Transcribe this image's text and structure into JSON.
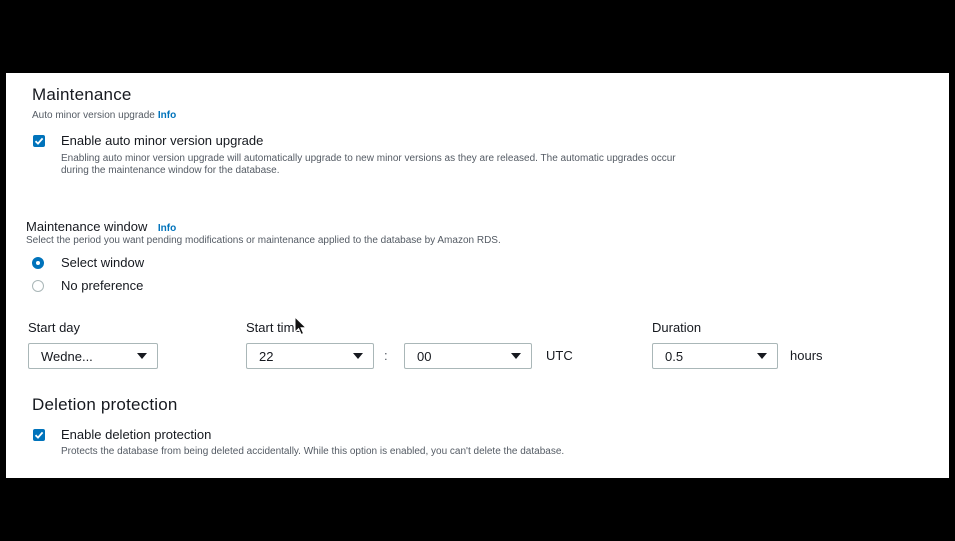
{
  "maintenance": {
    "title": "Maintenance",
    "subtitle": "Auto minor version upgrade",
    "subtitle_info": "Info",
    "auto_upgrade": {
      "checked": true,
      "label": "Enable auto minor version upgrade",
      "description": "Enabling auto minor version upgrade will automatically upgrade to new minor versions as they are released. The automatic upgrades occur during the maintenance window for the database."
    }
  },
  "window": {
    "title": "Maintenance window",
    "info": "Info",
    "description": "Select the period you want pending modifications or maintenance applied to the database by Amazon RDS.",
    "options": [
      {
        "label": "Select window",
        "selected": true
      },
      {
        "label": "No preference",
        "selected": false
      }
    ],
    "start_day": {
      "label": "Start day",
      "value": "Wedne..."
    },
    "start_time": {
      "label": "Start time",
      "hour": "22",
      "separator": ":",
      "minute": "00",
      "timezone": "UTC"
    },
    "duration": {
      "label": "Duration",
      "value": "0.5",
      "unit": "hours"
    }
  },
  "deletion": {
    "title": "Deletion protection",
    "checked": true,
    "label": "Enable deletion protection",
    "description": "Protects the database from being deleted accidentally. While this option is enabled, you can't delete the database."
  },
  "colors": {
    "accent": "#0073bb",
    "text": "#16191f",
    "secondary_text": "#545b64",
    "border": "#aab7b8"
  }
}
